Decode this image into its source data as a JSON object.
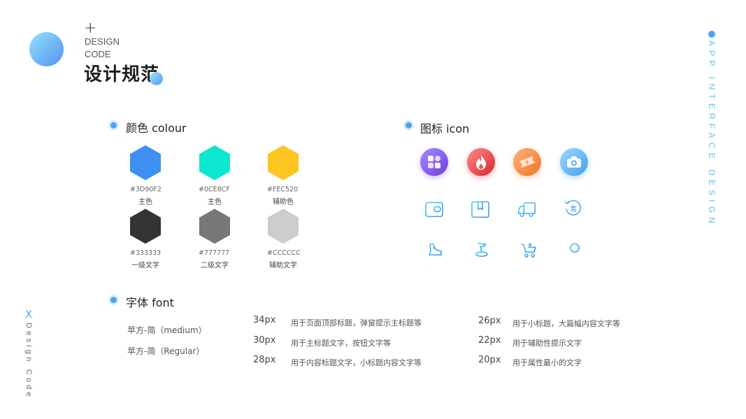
{
  "header": {
    "plus": "+",
    "design_line1": "DESIGN",
    "design_line2": "CODE",
    "title": "设计规范"
  },
  "side_right_text": "APP INTERFACE DESIGN",
  "side_left_mark": "X",
  "side_left_text": "Design Code",
  "colour_section": {
    "title": "颜色  colour",
    "swatches": [
      {
        "hex": "#3D90F2",
        "label": "主色",
        "color": "#3D90F2"
      },
      {
        "hex": "#0CE8CF",
        "label": "主色",
        "color": "#0CE8CF"
      },
      {
        "hex": "#FEC520",
        "label": "辅助色",
        "color": "#FEC520"
      },
      {
        "hex": "#333333",
        "label": "一级文字",
        "color": "#333333"
      },
      {
        "hex": "#777777",
        "label": "二级文字",
        "color": "#777777"
      },
      {
        "hex": "#CCCCCC",
        "label": "辅助文字",
        "color": "#CCCCCC"
      }
    ]
  },
  "icon_section": {
    "title": "图标  icon",
    "icons": [
      "apps-icon",
      "fire-icon",
      "ticket-icon",
      "camera-icon",
      "wallet-icon",
      "box-icon",
      "truck-icon",
      "after-sale-icon",
      "sneaker-icon",
      "flag-icon",
      "cart-icon",
      "user-icon"
    ],
    "after_sale_char": "售"
  },
  "font_section": {
    "title": "字体  font",
    "families": [
      "苹方-简（medium）",
      "苹方-简（Regular）"
    ],
    "sizes": [
      {
        "px": "34px",
        "desc": "用于页面顶部标题，弹窗提示主标题等"
      },
      {
        "px": "30px",
        "desc": "用于主标题文字，按钮文字等"
      },
      {
        "px": "28px",
        "desc": "用于内容标题文字，小标题内容文字等"
      },
      {
        "px": "26px",
        "desc": "用于小标题，大篇幅内容文字等"
      },
      {
        "px": "22px",
        "desc": "用于辅助性提示文字"
      },
      {
        "px": "20px",
        "desc": "用于属性最小的文字"
      }
    ]
  }
}
